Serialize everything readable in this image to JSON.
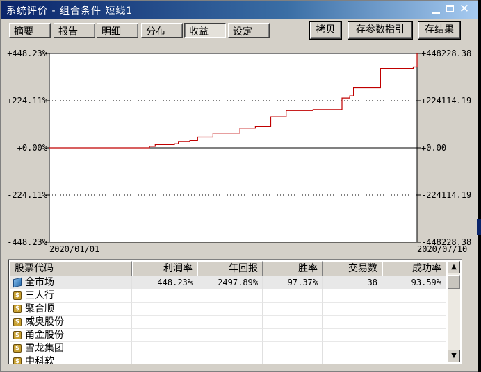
{
  "window": {
    "title": "系统评价 - 组合条件 短线1",
    "min_icon": "minimize-icon",
    "max_icon": "maximize-icon",
    "close_icon": "close-icon",
    "close_glyph": "✕"
  },
  "tabs": [
    {
      "label": "摘要",
      "active": false
    },
    {
      "label": "报告",
      "active": false
    },
    {
      "label": "明细",
      "active": false
    },
    {
      "label": "分布",
      "active": false
    },
    {
      "label": "收益",
      "active": true
    },
    {
      "label": "设定",
      "active": false
    }
  ],
  "buttons": {
    "copy": "拷贝",
    "save_params": "存参数指引",
    "save_results": "存结果"
  },
  "chart_data": {
    "type": "line",
    "y_left_ticks": [
      "+448.23%",
      "+224.11%",
      "+0.00%",
      "-224.11%",
      "-448.23%"
    ],
    "y_right_ticks": [
      "+448228.38",
      "+224114.19",
      "+0.00",
      "-224114.19",
      "-448228.38"
    ],
    "x_labels": [
      "2020/01/01",
      "2020/07/10"
    ],
    "ylim": [
      -448.23,
      448.23
    ],
    "grid": "dotted",
    "line_color": "#c00000",
    "series": [
      {
        "x": [
          "2020/01/01",
          "2020/02/22",
          "2020/02/25",
          "2020/03/06",
          "2020/03/08",
          "2020/03/14",
          "2020/03/18",
          "2020/03/26",
          "2020/04/09",
          "2020/04/17",
          "2020/04/25",
          "2020/05/03",
          "2020/05/17",
          "2020/06/01",
          "2020/06/05",
          "2020/06/07",
          "2020/06/21",
          "2020/07/08",
          "2020/07/10"
        ],
        "y": [
          0,
          7,
          15,
          19,
          30,
          35,
          51,
          70,
          93,
          101,
          148,
          177,
          182,
          237,
          247,
          285,
          377,
          384,
          448.23
        ]
      }
    ]
  },
  "table": {
    "headers": [
      "股票代码",
      "利润率",
      "年回报",
      "胜率",
      "交易数",
      "成功率"
    ],
    "rows": [
      {
        "name": "全市场",
        "icon": "market-icon",
        "profit": "448.23%",
        "annual": "2497.89%",
        "win": "97.37%",
        "trades": "38",
        "success": "93.59%"
      },
      {
        "name": "三人行",
        "icon": "stock-icon",
        "profit": "",
        "annual": "",
        "win": "",
        "trades": "",
        "success": ""
      },
      {
        "name": "聚合顺",
        "icon": "stock-icon",
        "profit": "",
        "annual": "",
        "win": "",
        "trades": "",
        "success": ""
      },
      {
        "name": "威奥股份",
        "icon": "stock-icon",
        "profit": "",
        "annual": "",
        "win": "",
        "trades": "",
        "success": ""
      },
      {
        "name": "甬金股份",
        "icon": "stock-icon",
        "profit": "",
        "annual": "",
        "win": "",
        "trades": "",
        "success": ""
      },
      {
        "name": "雪龙集团",
        "icon": "stock-icon",
        "profit": "",
        "annual": "",
        "win": "",
        "trades": "",
        "success": ""
      },
      {
        "name": "中科软",
        "icon": "stock-icon",
        "profit": "",
        "annual": "",
        "win": "",
        "trades": "",
        "success": ""
      }
    ]
  },
  "scrollbar": {
    "up": "▲",
    "down": "▼"
  }
}
